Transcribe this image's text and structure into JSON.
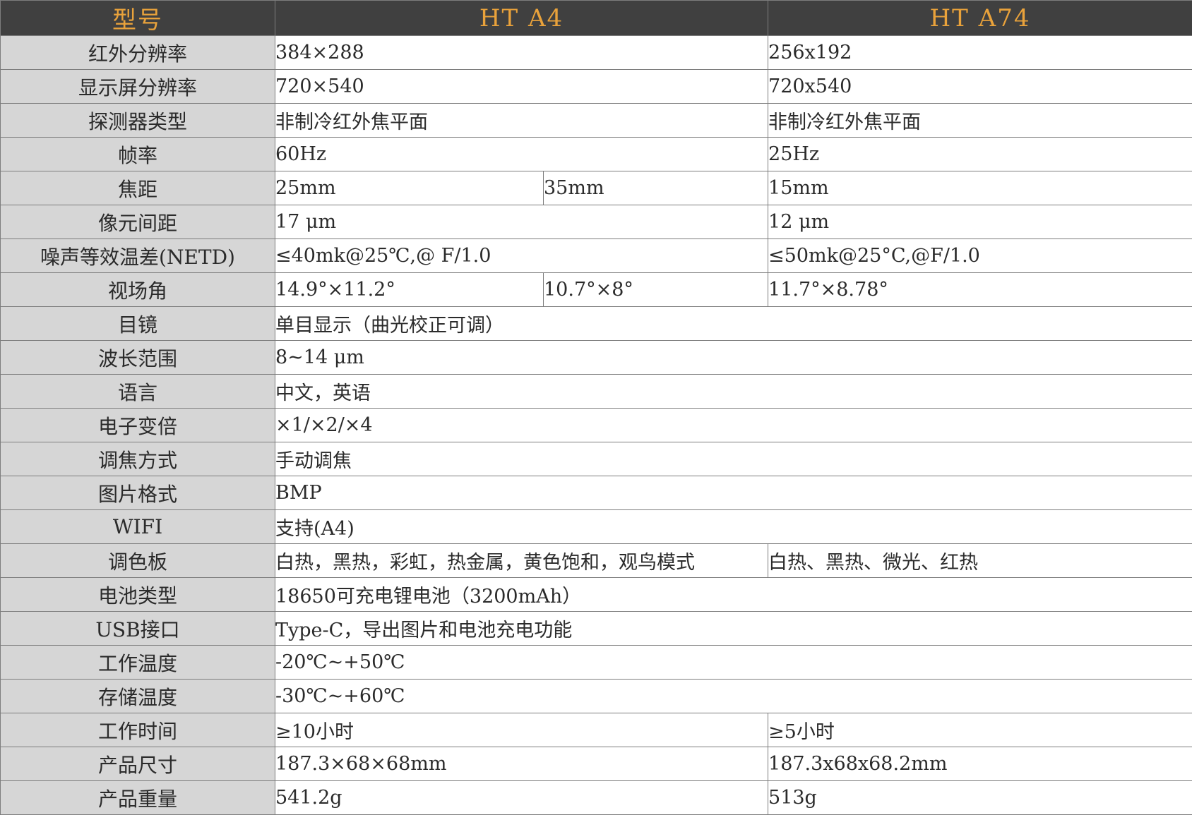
{
  "header": {
    "col_model": "型号",
    "col_a4": "HT A4",
    "col_a74": "HT A74"
  },
  "rows": {
    "ir_res": {
      "label": "红外分辨率",
      "a4": "384×288",
      "a74": "256x192"
    },
    "disp_res": {
      "label": "显示屏分辨率",
      "a4": "720×540",
      "a74": "720x540"
    },
    "detector": {
      "label": "探测器类型",
      "a4": "非制冷红外焦平面",
      "a74": "非制冷红外焦平面"
    },
    "frame_rate": {
      "label": "帧率",
      "a4": "60Hz",
      "a74": "25Hz"
    },
    "focal": {
      "label": "焦距",
      "a4_1": "25mm",
      "a4_2": "35mm",
      "a74": "15mm"
    },
    "pixel_pitch": {
      "label": "像元间距",
      "a4": "17 μm",
      "a74": "12 μm"
    },
    "netd": {
      "label": "噪声等效温差(NETD)",
      "a4": "≤40mk@25℃,@ F/1.0",
      "a74": "≤50mk@25°C,@F/1.0"
    },
    "fov": {
      "label": "视场角",
      "a4_1": "14.9°×11.2°",
      "a4_2": "10.7°×8°",
      "a74": "11.7°×8.78°"
    },
    "eyepiece": {
      "label": "目镜",
      "value": "单目显示（曲光校正可调）"
    },
    "wavelength": {
      "label": "波长范围",
      "value": "8~14 μm"
    },
    "language": {
      "label": "语言",
      "value": "中文，英语"
    },
    "zoom": {
      "label": "电子变倍",
      "value": "×1/×2/×4"
    },
    "focus": {
      "label": "调焦方式",
      "value": "手动调焦"
    },
    "image_format": {
      "label": "图片格式",
      "value": "BMP"
    },
    "wifi": {
      "label": "WIFI",
      "value": "支持(A4)"
    },
    "palette": {
      "label": "调色板",
      "a4": "白热，黑热，彩虹，热金属，黄色饱和，观鸟模式",
      "a74": "白热、黑热、微光、红热"
    },
    "battery": {
      "label": "电池类型",
      "value": "18650可充电锂电池（3200mAh）"
    },
    "usb": {
      "label": "USB接口",
      "value": "Type-C，导出图片和电池充电功能"
    },
    "op_temp": {
      "label": "工作温度",
      "value": "-20℃~+50℃"
    },
    "storage_temp": {
      "label": "存储温度",
      "value": "-30℃~+60℃"
    },
    "op_time": {
      "label": "工作时间",
      "a4": "≥10小时",
      "a74": "≥5小时"
    },
    "size": {
      "label": "产品尺寸",
      "a4": "187.3×68×68mm",
      "a74": "187.3x68x68.2mm"
    },
    "weight": {
      "label": "产品重量",
      "a4": "541.2g",
      "a74": "513g"
    }
  },
  "colors": {
    "header_bg": "#404040",
    "header_text": "#e9a23b",
    "label_bg": "#d6d6d6",
    "border": "#7d7d7d"
  }
}
